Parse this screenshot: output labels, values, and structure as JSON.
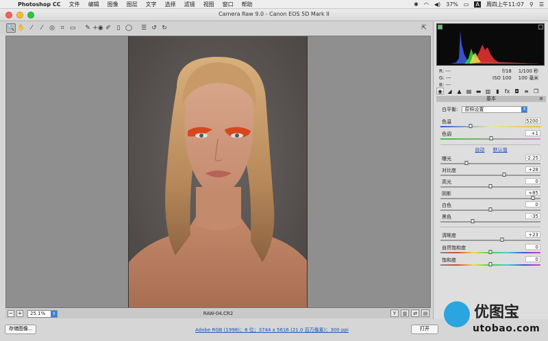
{
  "menubar": {
    "app": "Photoshop CC",
    "items": [
      "文件",
      "编辑",
      "图像",
      "图层",
      "文字",
      "选择",
      "滤镜",
      "视图",
      "窗口",
      "帮助"
    ],
    "battery": "37%",
    "input_method": "A",
    "clock": "周四上午11:07"
  },
  "window": {
    "title": "Camera Raw 9.0 - Canon EOS 5D Mark II",
    "traffic": {
      "close": "#fc5f57",
      "minimize": "#fdbc2e",
      "zoom": "#28c840"
    }
  },
  "toolbar": {
    "icons": [
      "zoom-icon",
      "hand-icon",
      "white-balance-icon",
      "color-sampler-icon",
      "target-adjust-icon",
      "crop-icon",
      "straighten-icon",
      "spot-removal-icon",
      "red-eye-icon",
      "adjustment-brush-icon",
      "graduated-filter-icon",
      "radial-filter-icon",
      "preferences-icon",
      "rotate-left-icon",
      "rotate-right-icon"
    ],
    "fullscreen_icon": "fullscreen-icon"
  },
  "status": {
    "zoom": "25.1%",
    "filename": "RAW-04.CR2"
  },
  "footer": {
    "save_label": "存储图像...",
    "workflow": "Adobe RGB (1998)；8 位；3744 x 5616 (21.0 百万像素)；300 ppi",
    "open_label": "打开"
  },
  "histogram": {
    "rgb_r": "R:  ---",
    "rgb_g": "G:  ---",
    "rgb_b": "B:  ---",
    "aperture": "f/18",
    "shutter": "1/100 秒",
    "iso": "ISO 100",
    "focal": "100 毫米"
  },
  "panel": {
    "title": "基本",
    "wb_label": "白平衡:",
    "wb_value": "原照设置",
    "auto": "自动",
    "default": "默认值",
    "sliders": {
      "temp": {
        "label": "色温",
        "value": "5200",
        "pos": 0.3
      },
      "tint": {
        "label": "色调",
        "value": "+1",
        "pos": 0.505
      },
      "exposure": {
        "label": "曝光",
        "value": "-2.25",
        "pos": 0.26
      },
      "contrast": {
        "label": "对比度",
        "value": "+28",
        "pos": 0.64
      },
      "highlights": {
        "label": "高光",
        "value": "0",
        "pos": 0.5
      },
      "shadows": {
        "label": "阴影",
        "value": "+85",
        "pos": 0.925
      },
      "whites": {
        "label": "白色",
        "value": "0",
        "pos": 0.5
      },
      "blacks": {
        "label": "黑色",
        "value": "-35",
        "pos": 0.325
      },
      "clarity": {
        "label": "清晰度",
        "value": "+23",
        "pos": 0.615
      },
      "vibrance": {
        "label": "自然饱和度",
        "value": "0",
        "pos": 0.5
      },
      "saturation": {
        "label": "饱和度",
        "value": "0",
        "pos": 0.5
      }
    }
  },
  "watermark": {
    "text": "优图宝",
    "url": "utobao.com"
  }
}
